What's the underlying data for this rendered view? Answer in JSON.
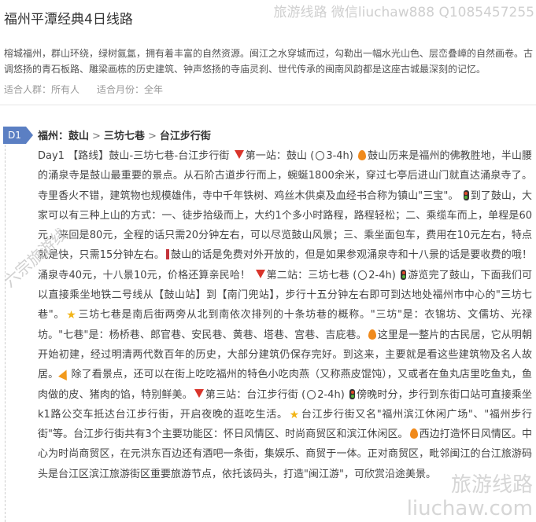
{
  "header": {
    "title": "福州平潭经典4日线路",
    "watermark": "旅游线路 微信liuchaw888 Q1085457255"
  },
  "intro": "榕城福州，群山环绕，绿树氤氲，拥有着丰富的自然资源。闽江之水穿城而过，勾勒出一幅水光山色、层峦叠嶂的自然画卷。古调悠扬的青石板路、雕梁画栋的历史建筑、钟声悠扬的寺庙灵刹、世代传承的闽南风韵都是这座古城最深刻的记忆。",
  "meta": {
    "people_label": "适合人群：",
    "people_value": "所有人",
    "month_label": "适合月份：",
    "month_value": "全年"
  },
  "day": {
    "badge": "D1",
    "route": [
      "福州：鼓山",
      "三坊七巷",
      "台江步行街"
    ],
    "route_sep": ">"
  },
  "content": {
    "t1": "Day1 【路线】鼓山-三坊七巷-台江步行街 ",
    "t2": "第一站：鼓山 (",
    "t3": "3-4h) ",
    "t4": "鼓山历来是福州的佛教胜地，半山腰的涌泉寺是鼓山最重要的景点。从石阶古道步行而上，蜿蜒1800余米，穿过七亭后进山门就直达涌泉寺了。寺里香火不错，建筑物也规模雄伟，寺中千年铁树、鸡丝木供桌及血经书合称为镇山\"三宝\"。 ",
    "t5": "到了鼓山，大家可以有三种上山的方式：一、徒步拾级而上，大约1个多小时路程，路程轻松；二、乘缆车而上，单程是60元，来回是80元，全程的话只需20分钟左右，可以尽览鼓山风景；三、乘坐面包车，费用在10元左右，特点就是快，只需15分钟左右。",
    "t6": "鼓山的话是免费对外开放的，但是如果参观涌泉寺和十八景的话是要收费的哦！涌泉寺40元，十八景10元，价格还算亲民哈！ ",
    "t7": "第二站：三坊七巷 (",
    "t8": "2-4h) ",
    "t9": "游览完了鼓山，下面我们可以直接乘坐地铁二号线从【鼓山站】到【南门兜站】，步行十五分钟左右即可到达地处福州市中心的\"三坊七巷\"。",
    "t10": "三坊七巷是南后街两旁从北到南依次排列的十条坊巷的概称。\"三坊\"是：衣锦坊、文儒坊、光禄坊。\"七巷\"是：杨桥巷、郎官巷、安民巷、黄巷、塔巷、宫巷、吉庇巷。",
    "t11": "这里是一整片的古民居，它从明朝开始初建，经过明清两代数百年的历史，大部分建筑仍保存完好。到这来，主要就是看这些建筑物及名人故居。",
    "t12": "除了看景点，还可以在街上吃吃福州的特色小吃肉燕（又称燕皮馄饨），又或者在鱼丸店里吃鱼丸，鱼肉做的皮、猪肉的馅，特别鲜美。",
    "t13": "第三站：台江步行街 (",
    "t14": "2-4h) ",
    "t15": "傍晚时分，步行到东街口站可直接乘坐k1路公交车抵达台江步行街，开启夜晚的逛吃生活。",
    "t16": "台江步行街又名\"福州滨江休闲广场\"、\"福州步行街\"等。台江步行街共有3个主要功能区：怀日风情区、时尚商贸区和滨江休闲区。",
    "t17": "西边打造怀日风情区。中心为时尚商贸区，在元洪东百边还有酒吧一条街，集娱乐、商贸于一体。正对商贸区，毗邻闽江的台江旅游码头是台江区滨江旅游街区重要旅游节点，依托该码头，打造\"闽江游\"，可欣赏沿途美景。"
  },
  "watermarks": {
    "left": "六宗旅游线",
    "bottom_1": "旅游线路",
    "bottom_2": "liuchaw.com"
  },
  "colors": {
    "badge_bg": "#5b7fc3",
    "marker_red": "#d9342b",
    "flame_orange": "#f08a1c",
    "star_gold": "#f2b416"
  },
  "icons": [
    "red-triangle-icon",
    "clock-icon",
    "flame-icon",
    "traffic-light-icon",
    "red-bar-icon",
    "star-icon",
    "pizza-icon"
  ]
}
